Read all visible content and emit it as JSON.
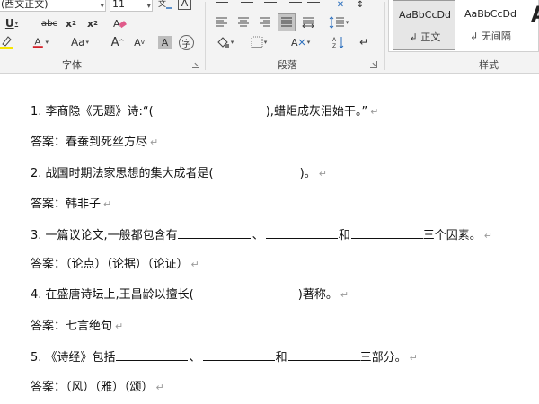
{
  "ribbon": {
    "font_group": {
      "font_name": "(西文正文)",
      "font_size": "11",
      "label": "字体",
      "change_case": "Aa",
      "grow": "A",
      "shrink": "A",
      "shade_char": "A",
      "phonetic": "字",
      "clear_icon_glyph": "A"
    },
    "paragraph_group": {
      "label": "段落"
    },
    "styles_group": {
      "label": "样式",
      "styles": [
        {
          "sample": "AaBbCcDd",
          "name": "正文"
        },
        {
          "sample": "AaBbCcDd",
          "name": "无间隔"
        }
      ],
      "big_sample": "A"
    }
  },
  "document": {
    "pilcrow": "↵",
    "lines": [
      {
        "pre": "1.  李商隐《无题》诗:“(",
        "post": "),蜡炬成灰泪始干。”"
      },
      {
        "text": "答案：春蚕到死丝方尽"
      },
      {
        "pre": "2.  战国时期法家思想的集大成者是(",
        "post": ")。"
      },
      {
        "text": "答案：韩非子"
      },
      {
        "pre": "3.  一篇议论文,一般都包含有",
        "sep1": "、",
        "sep2": "和",
        "post": "三个因素。"
      },
      {
        "text": "答案：（论点）（论据）（论证）"
      },
      {
        "pre": "4.  在盛唐诗坛上,王昌龄以擅长(",
        "post": ")著称。"
      },
      {
        "text": "答案：七言绝句"
      },
      {
        "pre": "5.    《诗经》包括",
        "sep1": "、",
        "sep2": "和",
        "post": "三部分。"
      },
      {
        "text": "答案：（风）（雅）（颂）"
      }
    ]
  }
}
